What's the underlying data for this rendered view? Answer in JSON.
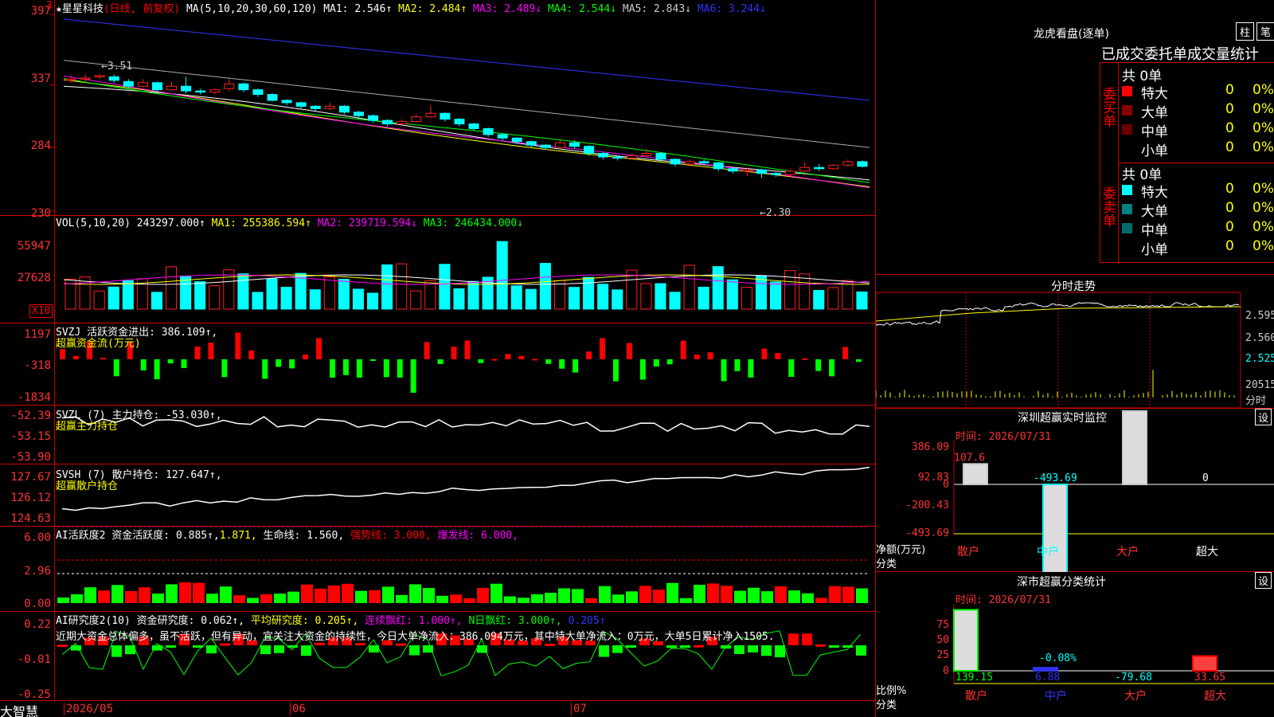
{
  "app": {
    "logo": "大智慧"
  },
  "main": {
    "mark": "3",
    "header": {
      "star": "★",
      "name": "星星科技",
      "mode": "(日线, 前复权)",
      "ma_prefix": "MA(5,10,20,30,60,120)",
      "ma1": "MA1: 2.546↑",
      "ma2": "MA2: 2.484↑",
      "ma3": "MA3: 2.489↓",
      "ma4": "MA4: 2.544↓",
      "ma5": "MA5: 2.843↓",
      "ma6": "MA6: 3.244↓"
    },
    "yticks": [
      "397",
      "337",
      "284",
      "230"
    ],
    "hi_label": "←3.51",
    "lo_label": "←2.30",
    "candles": [
      [
        3.41,
        3.42,
        3.45,
        3.39
      ],
      [
        3.42,
        3.43,
        3.46,
        3.4
      ],
      [
        3.44,
        3.45,
        3.46,
        3.42
      ],
      [
        3.44,
        3.41,
        3.46,
        3.39
      ],
      [
        3.4,
        3.36,
        3.42,
        3.34
      ],
      [
        3.36,
        3.39,
        3.42,
        3.35
      ],
      [
        3.39,
        3.33,
        3.4,
        3.31
      ],
      [
        3.33,
        3.36,
        3.4,
        3.32
      ],
      [
        3.36,
        3.32,
        3.44,
        3.3
      ],
      [
        3.32,
        3.31,
        3.34,
        3.29
      ],
      [
        3.31,
        3.33,
        3.34,
        3.29
      ],
      [
        3.34,
        3.38,
        3.42,
        3.32
      ],
      [
        3.38,
        3.33,
        3.39,
        3.31
      ],
      [
        3.33,
        3.29,
        3.34,
        3.27
      ],
      [
        3.29,
        3.24,
        3.3,
        3.23
      ],
      [
        3.24,
        3.22,
        3.25,
        3.2
      ],
      [
        3.22,
        3.19,
        3.23,
        3.17
      ],
      [
        3.19,
        3.17,
        3.2,
        3.15
      ],
      [
        3.17,
        3.19,
        3.22,
        3.16
      ],
      [
        3.19,
        3.14,
        3.2,
        3.12
      ],
      [
        3.14,
        3.11,
        3.15,
        3.09
      ],
      [
        3.11,
        3.07,
        3.12,
        3.05
      ],
      [
        3.07,
        3.04,
        3.08,
        3.02
      ],
      [
        3.04,
        3.06,
        3.08,
        3.03
      ],
      [
        3.06,
        3.1,
        3.12,
        3.05
      ],
      [
        3.1,
        3.13,
        3.2,
        3.09
      ],
      [
        3.13,
        3.08,
        3.14,
        3.06
      ],
      [
        3.08,
        3.04,
        3.09,
        3.02
      ],
      [
        3.04,
        3.0,
        3.05,
        2.98
      ],
      [
        3.0,
        2.95,
        3.01,
        2.93
      ],
      [
        2.95,
        2.92,
        2.96,
        2.9
      ],
      [
        2.92,
        2.89,
        2.93,
        2.87
      ],
      [
        2.89,
        2.86,
        2.9,
        2.84
      ],
      [
        2.86,
        2.84,
        2.87,
        2.82
      ],
      [
        2.84,
        2.88,
        2.9,
        2.83
      ],
      [
        2.88,
        2.85,
        2.9,
        2.83
      ],
      [
        2.85,
        2.79,
        2.86,
        2.77
      ],
      [
        2.79,
        2.76,
        2.8,
        2.74
      ],
      [
        2.76,
        2.75,
        2.77,
        2.73
      ],
      [
        2.75,
        2.77,
        2.79,
        2.74
      ],
      [
        2.77,
        2.79,
        2.83,
        2.76
      ],
      [
        2.79,
        2.74,
        2.8,
        2.72
      ],
      [
        2.74,
        2.7,
        2.75,
        2.68
      ],
      [
        2.7,
        2.72,
        2.74,
        2.68
      ],
      [
        2.72,
        2.71,
        2.74,
        2.69
      ],
      [
        2.71,
        2.66,
        2.72,
        2.64
      ],
      [
        2.66,
        2.64,
        2.67,
        2.62
      ],
      [
        2.64,
        2.65,
        2.67,
        2.6
      ],
      [
        2.65,
        2.62,
        2.66,
        2.58
      ],
      [
        2.62,
        2.61,
        2.63,
        2.59
      ],
      [
        2.61,
        2.64,
        2.66,
        2.6
      ],
      [
        2.64,
        2.67,
        2.71,
        2.63
      ],
      [
        2.67,
        2.66,
        2.7,
        2.64
      ],
      [
        2.66,
        2.69,
        2.7,
        2.65
      ],
      [
        2.69,
        2.72,
        2.74,
        2.68
      ],
      [
        2.72,
        2.68,
        2.73,
        2.67
      ]
    ],
    "ma_colors": [
      "#ffffff",
      "#ffff00",
      "#ff00ff",
      "#00ff00",
      "#aaaaaa",
      "#3333ff"
    ],
    "ma_ends": [
      [
        3.36,
        2.55
      ],
      [
        3.38,
        2.49
      ],
      [
        3.41,
        2.49
      ],
      [
        3.42,
        2.55
      ],
      [
        3.58,
        2.84
      ],
      [
        3.93,
        3.24
      ]
    ],
    "vol": {
      "header": "VOL(5,10,20)",
      "v": "243297.000↑",
      "ma1": "MA1: 255386.594↑",
      "ma2": "MA2: 239719.594↓",
      "ma3": "MA3: 246434.000↓",
      "yticks": [
        "55947",
        "27628"
      ],
      "unit": "X10"
    },
    "svzj": {
      "header": "SVZJ  活跃资金进出: 386.109↑,",
      "sub": "超赢资金流(万元)",
      "yticks": [
        "1197",
        "-318",
        "-1834"
      ]
    },
    "svzl": {
      "header": "SVZL (7) 主力持仓: -53.030↑,",
      "sub": "超赢主力持仓",
      "yticks": [
        "-52.39",
        "-53.15",
        "-53.90"
      ]
    },
    "svsh": {
      "header": "SVSH (7) 散户持仓: 127.647↑,",
      "sub": "超赢散户持仓",
      "yticks": [
        "127.67",
        "126.12",
        "124.63"
      ]
    },
    "ai1": {
      "h1": "AI活跃度2 资金活跃度: 0.885↑,",
      "h2": "1.871,",
      "h3": "生命线: 1.560,",
      "h4": "强势线: 3.000,",
      "h5": "爆发线: 6.000,",
      "yticks": [
        "6.00",
        "2.96",
        "0.00"
      ]
    },
    "ai2": {
      "h1": "AI研究度2(10) 资金研究度: 0.062↑,",
      "h2": "平均研究度: 0.205↑,",
      "h3": "连续飘红: 1.000↑,",
      "h4": "N日飘红: 3.000↑,",
      "h5": "0.205↑",
      "text": "近期大资金总体偏多，虽不活跃，但有异动，宜关注大资金的持续性，今日大单净流入：386.094万元，其中特大单净流入：0万元，大单5日累计净入1505.",
      "yticks": [
        "0.22",
        "-0.01",
        "-0.25"
      ]
    },
    "dates": [
      "2026/05",
      "06",
      "07"
    ]
  },
  "right": {
    "title": "龙虎看盘(逐单)",
    "btn1": "柱",
    "btn2": "笔",
    "stat_title": "已成交委托单成交量统计",
    "buy": {
      "side": "委买单",
      "total": "共 0单",
      "rows": [
        {
          "label": "特大",
          "count": "0",
          "pct": "0%",
          "color": "#ff0000"
        },
        {
          "label": "大单",
          "count": "0",
          "pct": "0%",
          "color": "#8b0000"
        },
        {
          "label": "中单",
          "count": "0",
          "pct": "0%",
          "color": "#6b0000"
        },
        {
          "label": "小单",
          "count": "0",
          "pct": "0%",
          "color": ""
        }
      ]
    },
    "sell": {
      "side": "委卖单",
      "total": "共 0单",
      "rows": [
        {
          "label": "特大",
          "count": "0",
          "pct": "0%",
          "color": "#00ffff"
        },
        {
          "label": "大单",
          "count": "0",
          "pct": "0%",
          "color": "#008080"
        },
        {
          "label": "中单",
          "count": "0",
          "pct": "0%",
          "color": "#006b6b"
        },
        {
          "label": "小单",
          "count": "0",
          "pct": "0%",
          "color": ""
        }
      ]
    },
    "intraday": {
      "title": "分时走势",
      "yticks": [
        "2.595",
        "2.560",
        "2.525"
      ],
      "vol_label": "20515",
      "unit": "分时"
    },
    "monitor": {
      "title": "深圳超赢实时监控",
      "set": "设",
      "time": "时间: 2026/07/31",
      "yticks": [
        "386.09",
        "92.83",
        "0",
        "-200.43",
        "-493.69"
      ],
      "ylabel": "净额(万元)",
      "xlabel": "分类",
      "cats": [
        "散户",
        "中户",
        "大户",
        "超大"
      ],
      "values": [
        "107.6",
        "-493.69",
        "386.09",
        "0"
      ],
      "nums": [
        107.6,
        -493.69,
        386.09,
        0
      ]
    },
    "classify": {
      "title": "深市超赢分类统计",
      "set": "设",
      "time": "时间: 2026/07/31",
      "yticks": [
        "75",
        "50",
        "25",
        "0"
      ],
      "ylabel": "比例%",
      "xlabel": "分类",
      "cats": [
        "散户",
        "中户",
        "大户",
        "超大"
      ],
      "values": [
        "139.15",
        "6.88",
        "-79.68",
        "33.65"
      ],
      "bar_label": "-0.08%",
      "nums": [
        139.15,
        6.88,
        -79.68,
        33.65
      ]
    }
  }
}
